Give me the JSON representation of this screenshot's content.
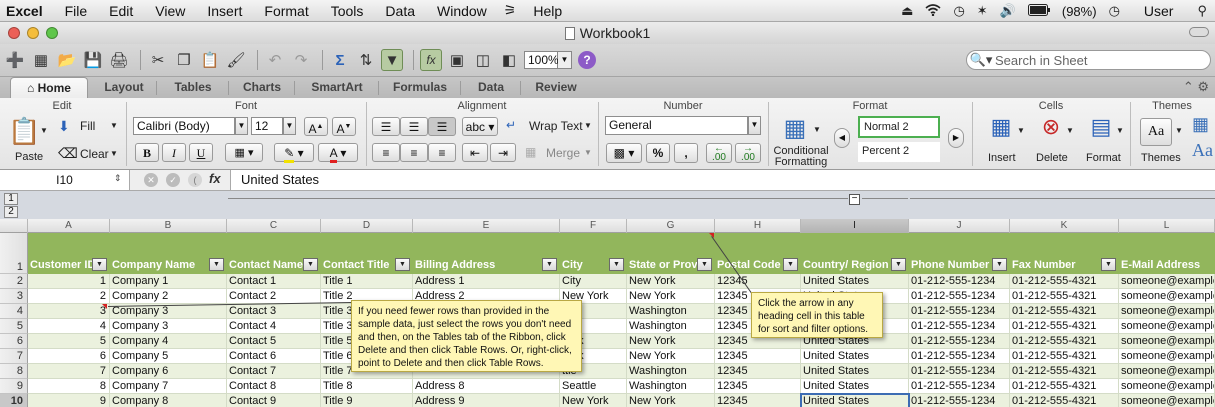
{
  "menubar": {
    "app": "Excel",
    "items": [
      "File",
      "Edit",
      "View",
      "Insert",
      "Format",
      "Tools",
      "Data",
      "Window",
      "Help"
    ],
    "battery": "(98%)",
    "user": "User"
  },
  "window": {
    "title": "Workbook1"
  },
  "toolbar": {
    "zoom": "100%",
    "search_placeholder": "Search in Sheet"
  },
  "tabs": [
    "Home",
    "Layout",
    "Tables",
    "Charts",
    "SmartArt",
    "Formulas",
    "Data",
    "Review"
  ],
  "ribbon": {
    "groups": [
      "Edit",
      "Font",
      "Alignment",
      "Number",
      "Format",
      "Cells",
      "Themes"
    ],
    "fill": "Fill",
    "clear": "Clear",
    "paste": "Paste",
    "font_name": "Calibri (Body)",
    "font_size": "12",
    "bold": "B",
    "italic": "I",
    "underline": "U",
    "abc": "abc",
    "wrap_text": "Wrap Text",
    "merge": "Merge",
    "number_format": "General",
    "percent": "%",
    "comma": ",",
    "dec_inc": ".00",
    "dec_dec": ".00",
    "conditional_formatting_1": "Conditional",
    "conditional_formatting_2": "Formatting",
    "style_1": "Normal 2",
    "style_2": "Percent 2",
    "insert": "Insert",
    "delete": "Delete",
    "format": "Format",
    "themes": "Themes",
    "aa": "Aa"
  },
  "formula_bar": {
    "name_box": "I10",
    "fx": "fx",
    "value": "United States"
  },
  "outline_levels": [
    "1",
    "2"
  ],
  "columns": [
    "A",
    "B",
    "C",
    "D",
    "E",
    "F",
    "G",
    "H",
    "I",
    "J",
    "K",
    "L"
  ],
  "headers": [
    "Customer ID",
    "Company Name",
    "Contact Name",
    "Contact Title",
    "Billing Address",
    "City",
    "State or Provi",
    "Postal Code",
    "Country/ Region",
    "Phone Number",
    "Fax Number",
    "E-Mail Address"
  ],
  "row_numbers": [
    "1",
    "2",
    "3",
    "4",
    "5",
    "6",
    "7",
    "8",
    "9",
    "10"
  ],
  "rows": [
    [
      "1",
      "Company 1",
      "Contact 1",
      "Title 1",
      "Address 1",
      "City",
      "New York",
      "12345",
      "United States",
      "01-212-555-1234",
      "01-212-555-4321",
      "someone@example"
    ],
    [
      "2",
      "Company 2",
      "Contact 2",
      "Title 2",
      "Address 2",
      "New York",
      "New York",
      "12345",
      "United States",
      "01-212-555-1234",
      "01-212-555-4321",
      "someone@example"
    ],
    [
      "3",
      "Company 3",
      "Contact 3",
      "Title 3",
      "",
      "ttle",
      "Washington",
      "12345",
      "",
      "01-212-555-1234",
      "01-212-555-4321",
      "someone@example"
    ],
    [
      "4",
      "Company 3",
      "Contact 4",
      "Title 3",
      "",
      "ttle",
      "Washington",
      "12345",
      "United States",
      "01-212-555-1234",
      "01-212-555-4321",
      "someone@example"
    ],
    [
      "5",
      "Company 4",
      "Contact 5",
      "Title 5",
      "",
      "York",
      "New York",
      "12345",
      "United States",
      "01-212-555-1234",
      "01-212-555-4321",
      "someone@example"
    ],
    [
      "6",
      "Company 5",
      "Contact 6",
      "Title 6",
      "",
      "York",
      "New York",
      "12345",
      "United States",
      "01-212-555-1234",
      "01-212-555-4321",
      "someone@example"
    ],
    [
      "7",
      "Company 6",
      "Contact 7",
      "Title 7",
      "",
      "ttle",
      "Washington",
      "12345",
      "United States",
      "01-212-555-1234",
      "01-212-555-4321",
      "someone@example"
    ],
    [
      "8",
      "Company 7",
      "Contact 8",
      "Title 8",
      "Address 8",
      "Seattle",
      "Washington",
      "12345",
      "United States",
      "01-212-555-1234",
      "01-212-555-4321",
      "someone@example"
    ],
    [
      "9",
      "Company 8",
      "Contact 9",
      "Title 9",
      "Address 9",
      "New York",
      "New York",
      "12345",
      "United States",
      "01-212-555-1234",
      "01-212-555-4321",
      "someone@example"
    ]
  ],
  "comments": {
    "left": "If you need fewer rows than provided in the sample data, just select the rows you don't need and then, on the Tables tab of the Ribbon, click Delete and then click Table Rows. Or, right-click, point to Delete and then click Table Rows.",
    "right": "Click the arrow in any heading cell in this table for sort and filter options."
  },
  "colors": {
    "header_green": "#92b65c",
    "band_green": "#ebf1de",
    "comment_yellow": "#fff7b5",
    "selection_blue": "#3c6cb3"
  },
  "icons": [
    "wifi-icon",
    "bluetooth-icon",
    "volume-icon",
    "battery-icon",
    "search-icon"
  ]
}
